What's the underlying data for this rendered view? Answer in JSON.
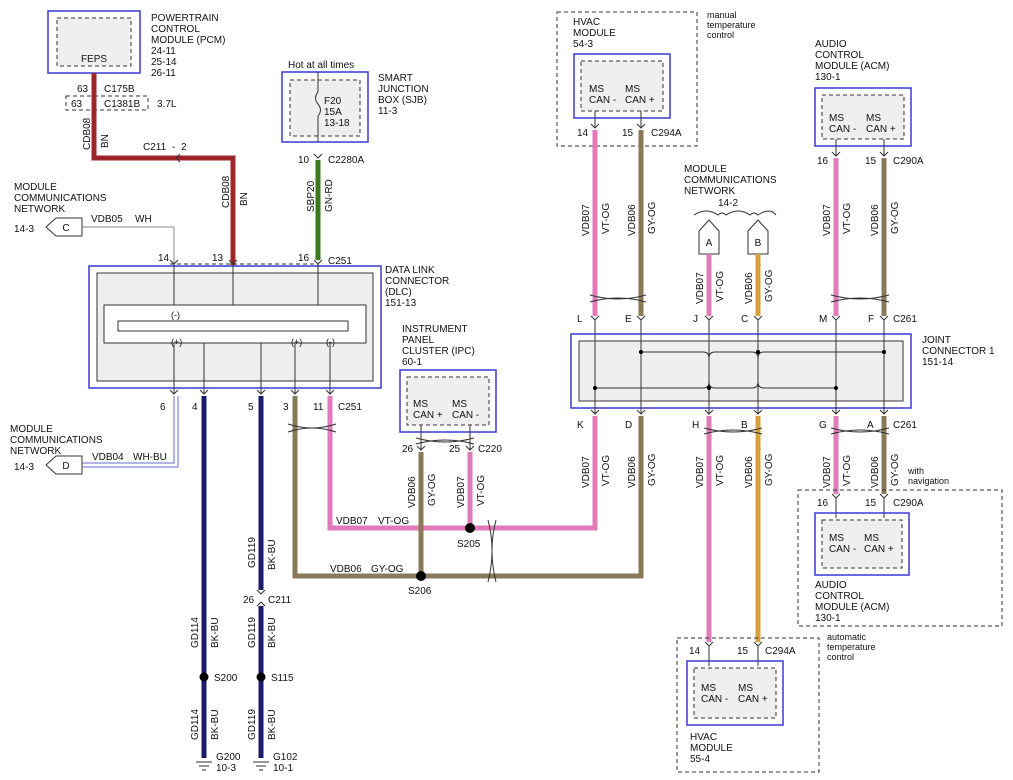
{
  "colors": {
    "BN": "#a3272b",
    "GN-RD": "#3a7a1c",
    "VT-OG": "#e07ab8",
    "GY-OG": "#8a7a5a",
    "BK-BU": "#1a1a6e",
    "WH": "#666666",
    "WH-BU": "#6a6ad8",
    "module_border": "#3a3ad6",
    "splice": "#000000"
  },
  "pcm": {
    "title": "POWERTRAIN CONTROL MODULE (PCM)",
    "lines": [
      "POWERTRAIN",
      "CONTROL",
      "MODULE (PCM)",
      "24-11",
      "25-14",
      "26-11"
    ],
    "inner": "FEPS",
    "pin": "63",
    "conn": "C175B",
    "opt_pin": "63",
    "opt_conn": "C1381B",
    "opt_label": "3.7L"
  },
  "wire_bn": {
    "circuit": "CDB08",
    "color": "BN",
    "inline": "C211",
    "inline_pin": "2"
  },
  "mcn_c": {
    "title_lines": [
      "MODULE",
      "COMMUNICATIONS",
      "NETWORK"
    ],
    "page": "14-3",
    "letter": "C",
    "circuit": "VDB05",
    "color": "WH"
  },
  "mcn_d": {
    "title_lines": [
      "MODULE",
      "COMMUNICATIONS",
      "NETWORK"
    ],
    "page": "14-3",
    "letter": "D",
    "circuit": "VDB04",
    "color": "WH-BU"
  },
  "mcn_ab": {
    "title_lines": [
      "MODULE",
      "COMMUNICATIONS",
      "NETWORK"
    ],
    "page": "14-2",
    "letter_a": "A",
    "letter_b": "B"
  },
  "sjb": {
    "hot": "Hot at all times",
    "lines": [
      "SMART",
      "JUNCTION",
      "BOX (SJB)",
      "11-3"
    ],
    "fuse_lines": [
      "F20",
      "15A",
      "13-18"
    ],
    "pin": "10",
    "conn": "C2280A",
    "circuit": "SBP20",
    "color": "GN-RD"
  },
  "dlc": {
    "lines": [
      "DATA LINK",
      "CONNECTOR",
      "(DLC)",
      "151-13"
    ],
    "top_pins": [
      "14",
      "13",
      "16"
    ],
    "top_conn": "C251",
    "bottom_pins": [
      "6",
      "4",
      "5",
      "3",
      "11"
    ],
    "bottom_conn": "C251",
    "marks_top": "(-)",
    "marks_bottom": [
      "(+)",
      "(+)",
      "(-)"
    ]
  },
  "ipc": {
    "lines": [
      "INSTRUMENT",
      "PANEL",
      "CLUSTER (IPC)",
      "60-1"
    ],
    "can_plus": [
      "MS",
      "CAN +"
    ],
    "can_minus": [
      "MS",
      "CAN -"
    ],
    "pin_plus": "26",
    "pin_minus": "25",
    "conn": "C220"
  },
  "hvac_top": {
    "note": [
      "manual",
      "temperature",
      "control"
    ],
    "lines": [
      "HVAC",
      "MODULE",
      "54-3"
    ],
    "can_minus": [
      "MS",
      "CAN -"
    ],
    "can_plus": [
      "MS",
      "CAN +"
    ],
    "pin_a": "14",
    "pin_b": "15",
    "conn": "C294A"
  },
  "acm_top": {
    "lines": [
      "AUDIO",
      "CONTROL",
      "MODULE (ACM)",
      "130-1"
    ],
    "can_minus": [
      "MS",
      "CAN -"
    ],
    "can_plus": [
      "MS",
      "CAN +"
    ],
    "pin_a": "16",
    "pin_b": "15",
    "conn": "C290A"
  },
  "joint": {
    "lines": [
      "JOINT",
      "CONNECTOR 1",
      "151-14"
    ],
    "top_pins": [
      "L",
      "E",
      "J",
      "C",
      "M",
      "F"
    ],
    "top_conn": "C261",
    "bottom_pins": [
      "K",
      "D",
      "H",
      "B",
      "G",
      "A"
    ],
    "bottom_conn": "C261"
  },
  "acm_bottom": {
    "note": [
      "with",
      "navigation"
    ],
    "lines": [
      "AUDIO",
      "CONTROL",
      "MODULE (ACM)",
      "130-1"
    ],
    "can_minus": [
      "MS",
      "CAN -"
    ],
    "can_plus": [
      "MS",
      "CAN +"
    ],
    "pin_a": "16",
    "pin_b": "15",
    "conn": "C290A"
  },
  "hvac_bottom": {
    "note": [
      "automatic",
      "temperature",
      "control"
    ],
    "lines": [
      "HVAC",
      "MODULE",
      "55-4"
    ],
    "can_minus": [
      "MS",
      "CAN -"
    ],
    "can_plus": [
      "MS",
      "CAN +"
    ],
    "pin_a": "14",
    "pin_b": "15",
    "conn": "C294A"
  },
  "wires": {
    "vdb07": "VDB07",
    "vdb06": "VDB06",
    "vt_og": "VT-OG",
    "gy_og": "GY-OG",
    "gd114": "GD114",
    "gd119": "GD119",
    "bk_bu": "BK-BU"
  },
  "splices": {
    "s205": "S205",
    "s206": "S206",
    "s200": "S200",
    "s115": "S115"
  },
  "grounds": {
    "g200": "G200",
    "g200_page": "10-3",
    "g102": "G102",
    "g102_page": "10-1"
  },
  "c211_b": {
    "pin": "26",
    "conn": "C211"
  }
}
